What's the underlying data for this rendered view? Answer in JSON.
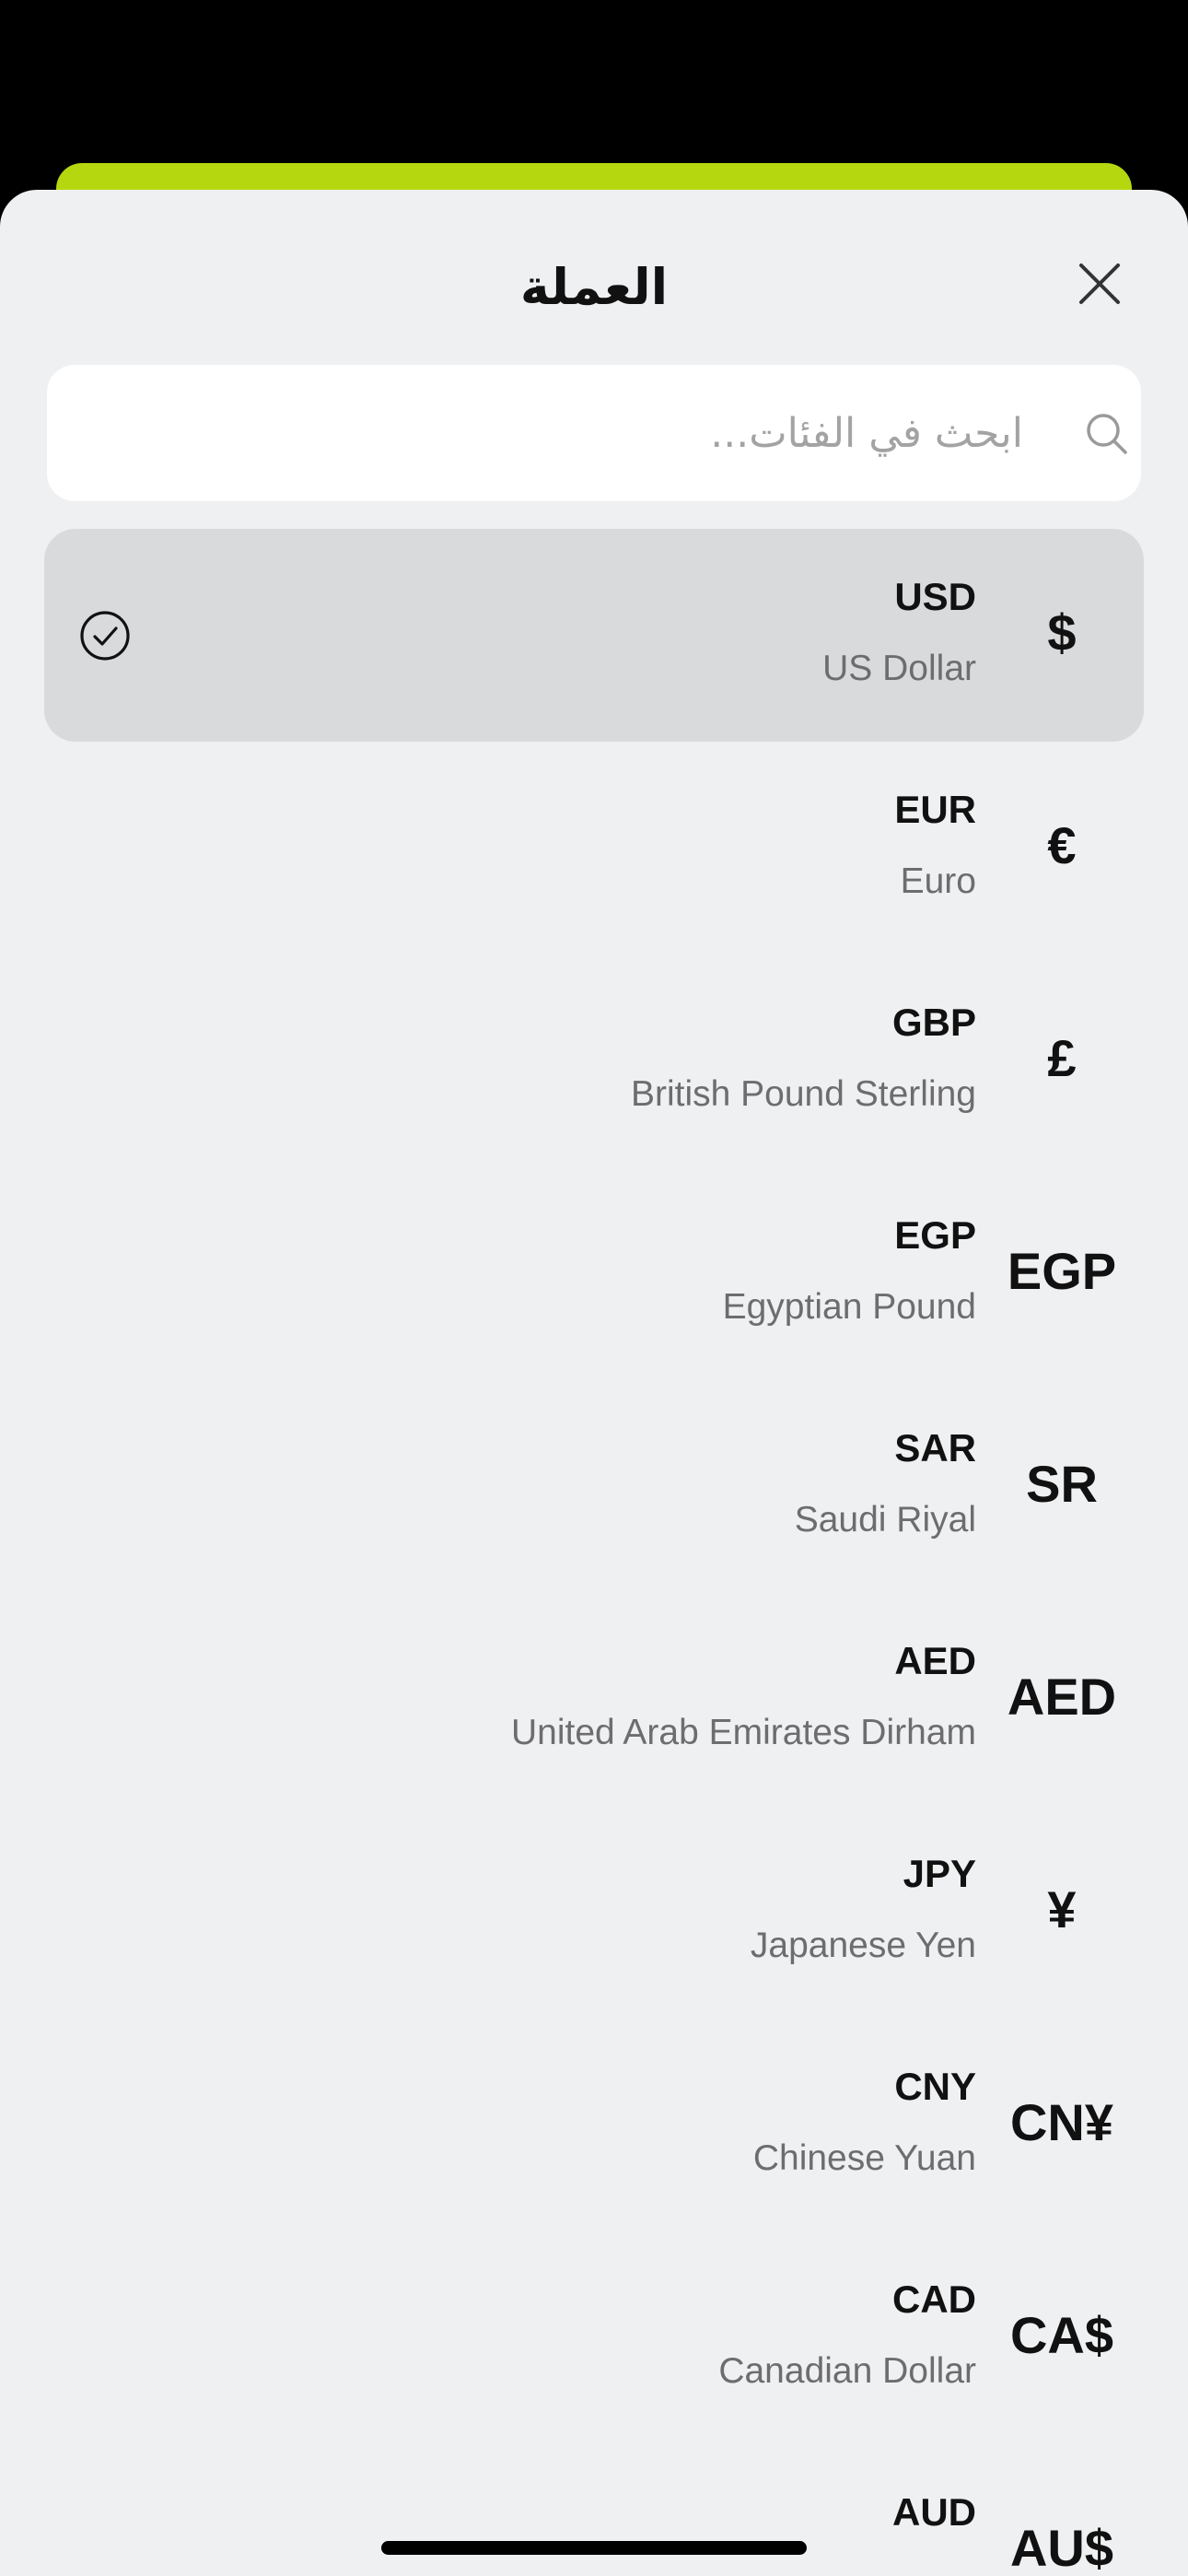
{
  "sheet": {
    "title": "العملة",
    "close_icon": "close-icon"
  },
  "search": {
    "placeholder": "ابحث في الفئات...",
    "value": "",
    "icon": "search-icon"
  },
  "currencies": [
    {
      "code": "USD",
      "name": "US Dollar",
      "symbol": "$",
      "selected": true
    },
    {
      "code": "EUR",
      "name": "Euro",
      "symbol": "€",
      "selected": false
    },
    {
      "code": "GBP",
      "name": "British Pound Sterling",
      "symbol": "£",
      "selected": false
    },
    {
      "code": "EGP",
      "name": "Egyptian Pound",
      "symbol": "EGP",
      "selected": false
    },
    {
      "code": "SAR",
      "name": "Saudi Riyal",
      "symbol": "SR",
      "selected": false
    },
    {
      "code": "AED",
      "name": "United Arab Emirates Dirham",
      "symbol": "AED",
      "selected": false
    },
    {
      "code": "JPY",
      "name": "Japanese Yen",
      "symbol": "¥",
      "selected": false
    },
    {
      "code": "CNY",
      "name": "Chinese Yuan",
      "symbol": "CN¥",
      "selected": false
    },
    {
      "code": "CAD",
      "name": "Canadian Dollar",
      "symbol": "CA$",
      "selected": false
    },
    {
      "code": "AUD",
      "name": "",
      "symbol": "AU$",
      "selected": false
    }
  ],
  "colors": {
    "accent": "#b5d70f",
    "sheet_background": "#eff0f2",
    "selected_row": "#d9dadc",
    "secondary_text": "#6d6d70"
  }
}
